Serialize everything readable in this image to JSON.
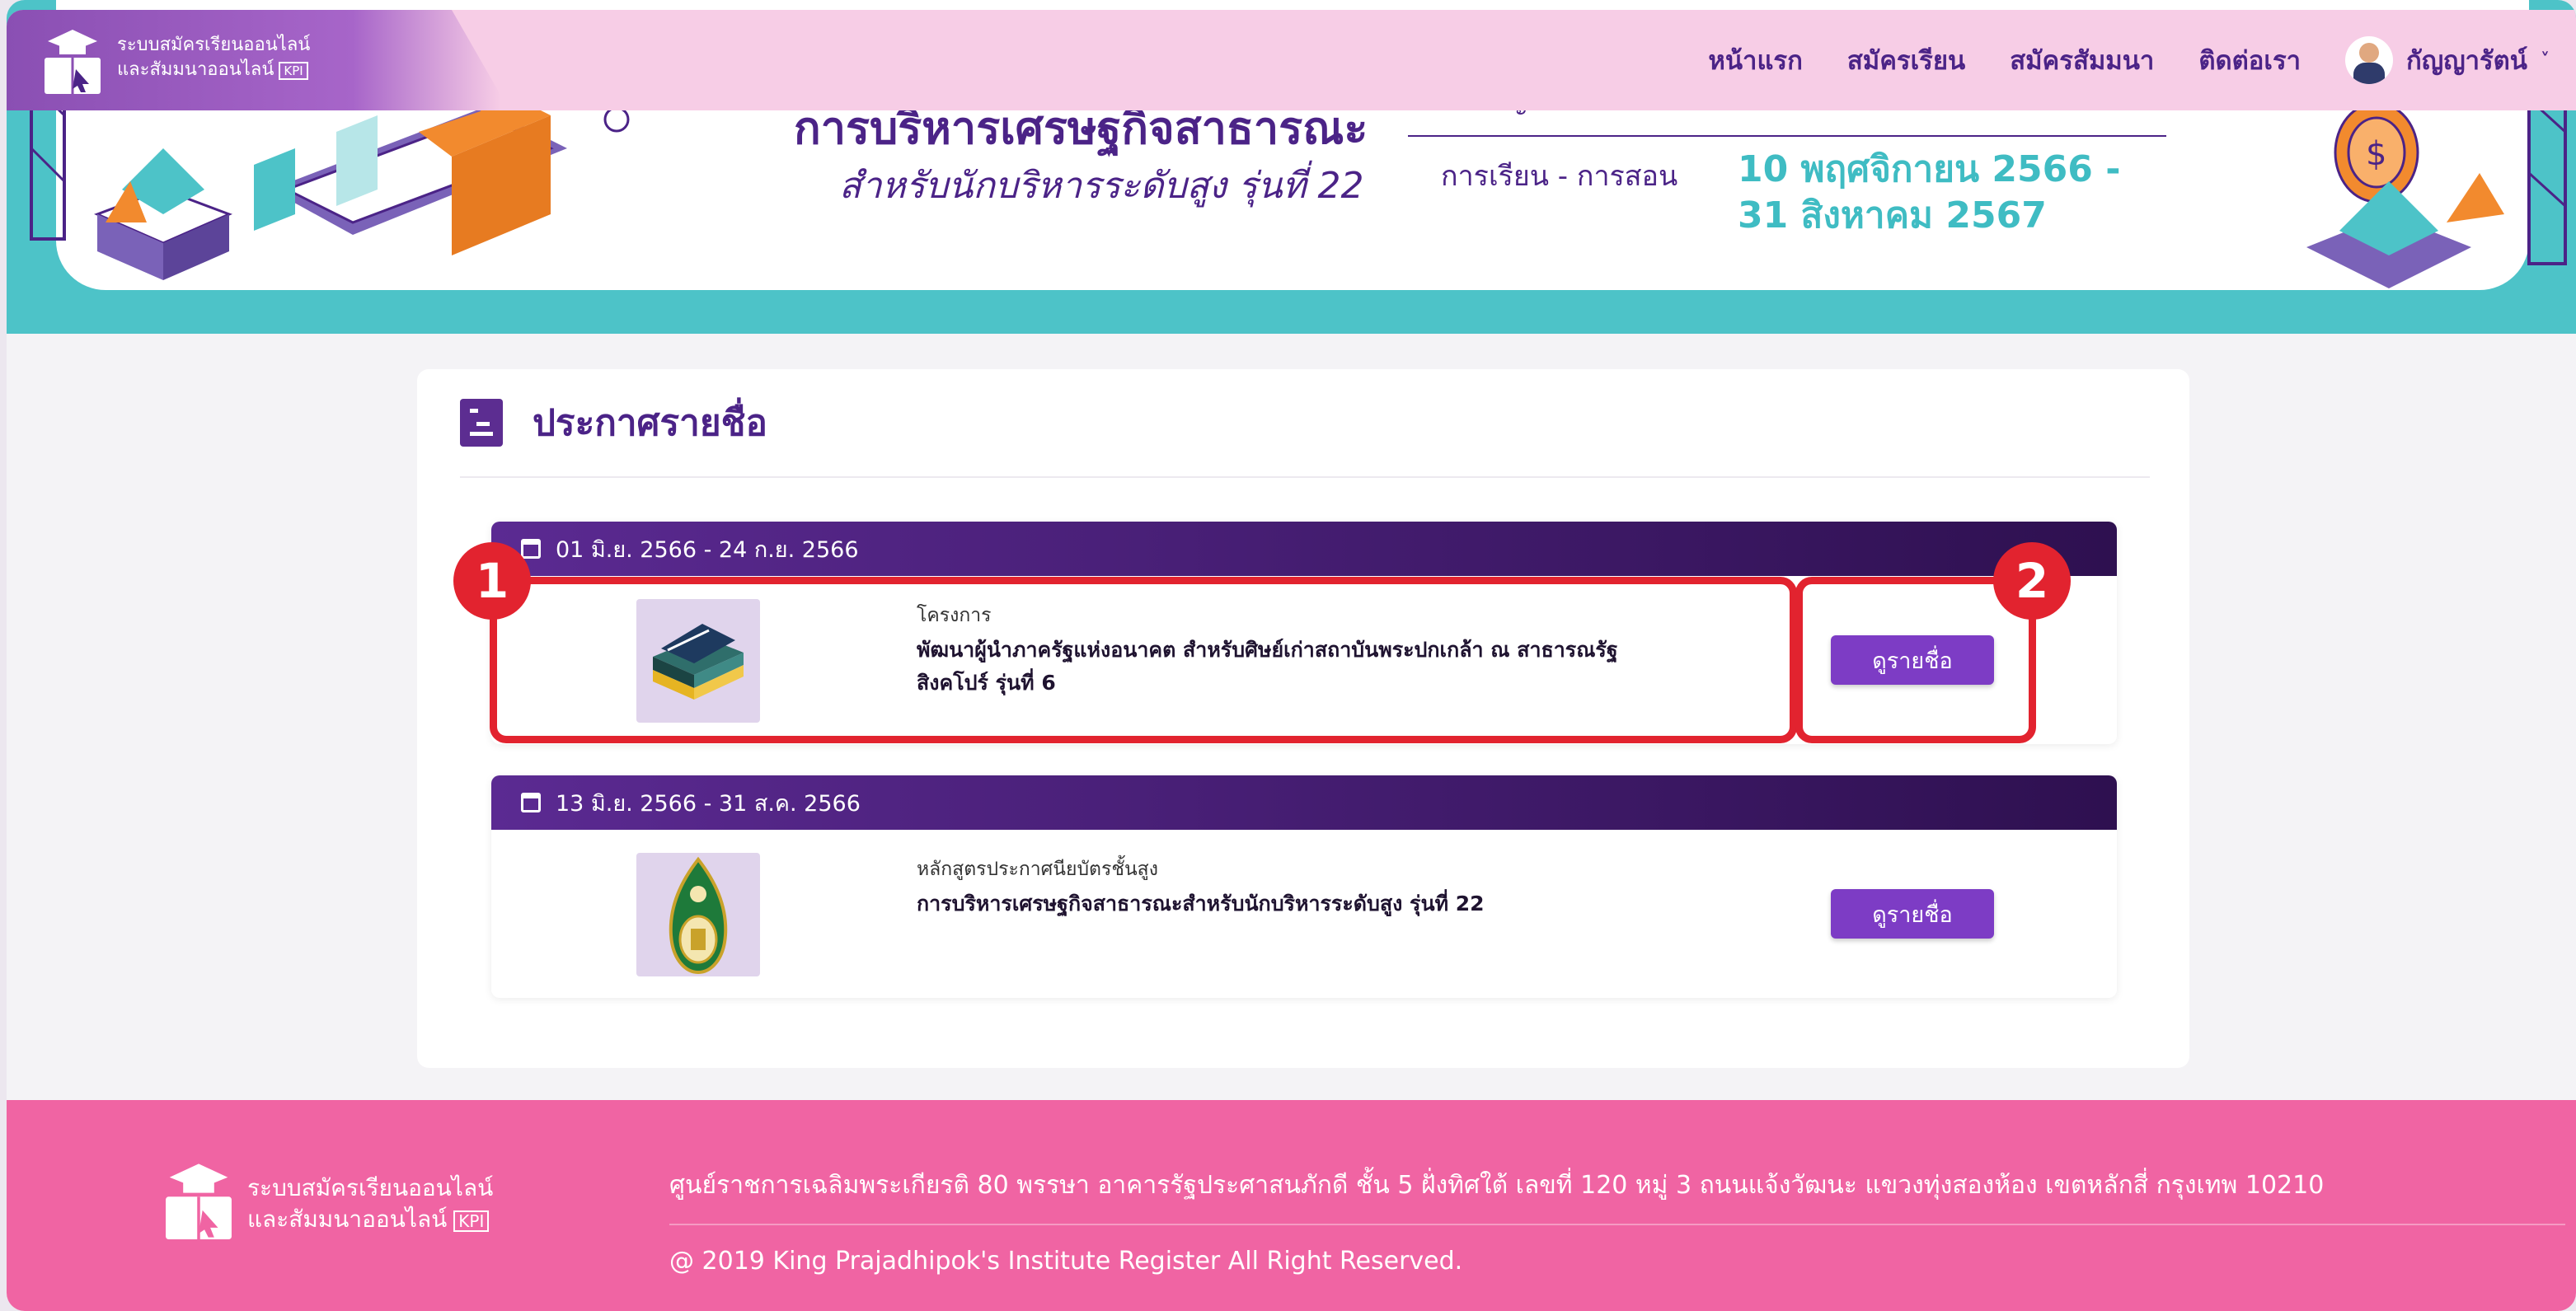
{
  "nav": {
    "logo_line1": "ระบบสมัครเรียนออนไลน์",
    "logo_line2": "และสัมมนาออนไลน์",
    "logo_badge": "KPI",
    "items": [
      "หน้าแรก",
      "สมัครเรียน",
      "สมัครสัมมนา",
      "ติดต่อเรา"
    ],
    "user_name": "กัญญารัตน์",
    "user_caret": "˅",
    "bg_color": "#f7cde6"
  },
  "banner": {
    "title": "การบริหารเศรษฐกิจสาธารณะ",
    "subtitle": "สำหรับนักบริหารระดับสูง รุ่นที่ 22",
    "top_label_partial": "และบัญชีบัณฑิต",
    "label": "การเรียน - การสอน",
    "date_line1": "10 พฤศจิกายน 2566 -",
    "date_line2": "31 สิงหาคม 2567"
  },
  "announcement": {
    "title": "ประกาศรายชื่อ",
    "items": [
      {
        "date_range": "01 มิ.ย. 2566 - 24 ก.ย. 2566",
        "category": "โครงการ",
        "name": "พัฒนาผู้นำภาครัฐแห่งอนาคต สำหรับศิษย์เก่าสถาบันพระปกเกล้า ณ สาธารณรัฐสิงคโปร์ รุ่นที่ 6",
        "button": "ดูรายชื่อ",
        "thumb_icon": "books-icon"
      },
      {
        "date_range": "13 มิ.ย. 2566 - 31 ส.ค. 2566",
        "category": "หลักสูตรประกาศนียบัตรชั้นสูง",
        "name": "การบริหารเศรษฐกิจสาธารณะสำหรับนักบริหารระดับสูง รุ่นที่ 22",
        "button": "ดูรายชื่อ",
        "thumb_icon": "emblem-icon"
      }
    ]
  },
  "annotations": {
    "marker1": "1",
    "marker2": "2",
    "color": "#e2232f"
  },
  "footer": {
    "logo_line1": "ระบบสมัครเรียนออนไลน์",
    "logo_line2": "และสัมมนาออนไลน์",
    "logo_badge": "KPI",
    "address": "ศูนย์ราชการเฉลิมพระเกียรติ 80 พรรษา อาคารรัฐประศาสนภักดี ชั้น 5 ฝั่งทิศใต้ เลขที่ 120 หมู่ 3 ถนนแจ้งวัฒนะ แขวงทุ่งสองห้อง เขตหลักสี่ กรุงเทพ 10210",
    "copyright": "@ 2019 King Prajadhipok's Institute Register All Right Reserved.",
    "bg_color": "#f064a3"
  }
}
